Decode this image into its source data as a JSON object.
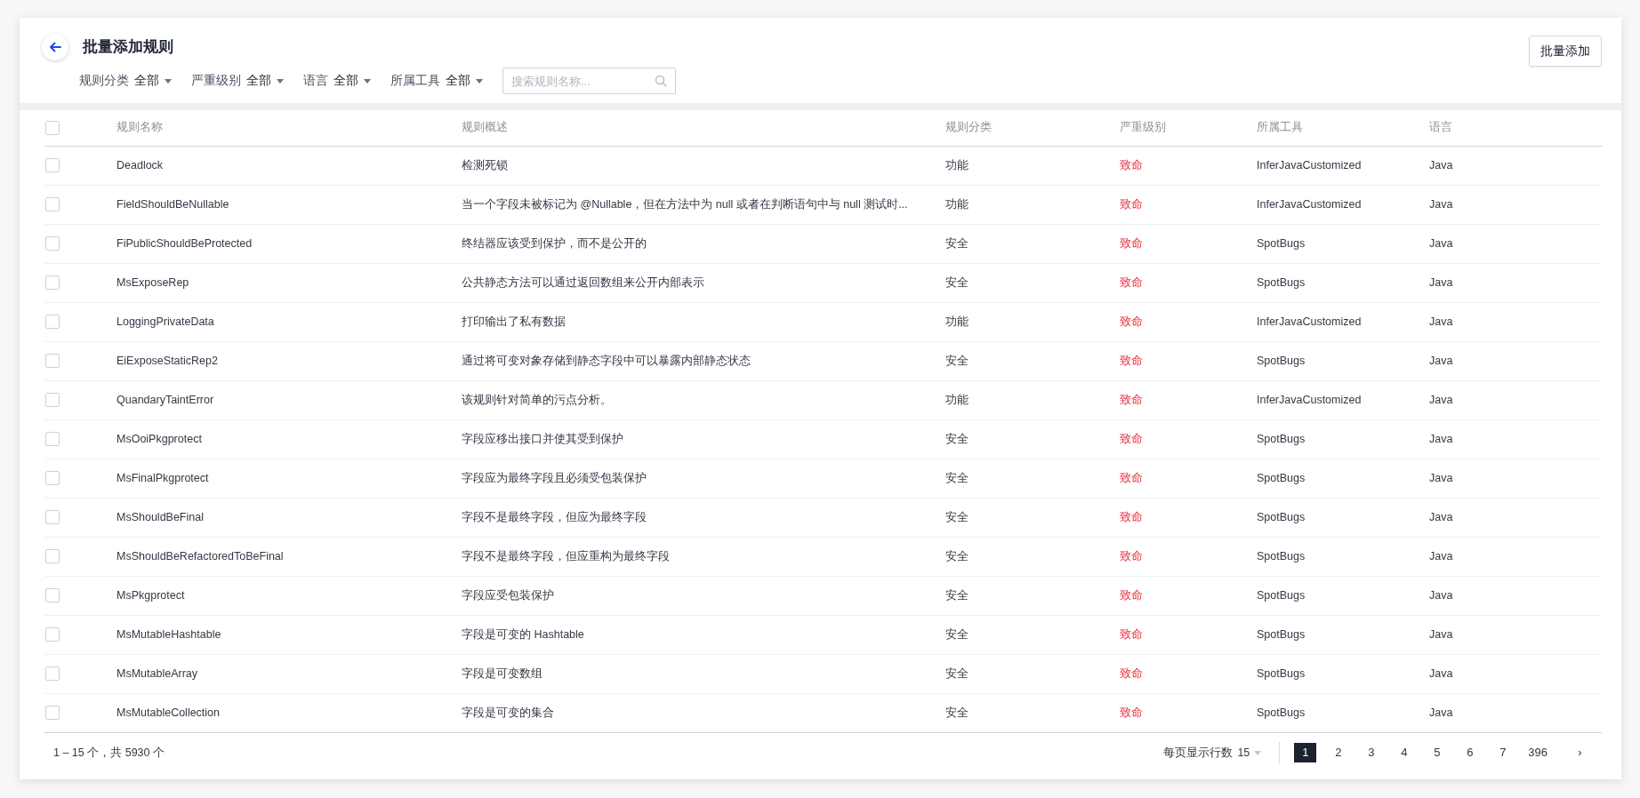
{
  "page": {
    "title": "批量添加规则",
    "action_button": "批量添加"
  },
  "filters": [
    {
      "label": "规则分类",
      "value": "全部"
    },
    {
      "label": "严重级别",
      "value": "全部"
    },
    {
      "label": "语言",
      "value": "全部"
    },
    {
      "label": "所属工具",
      "value": "全部"
    }
  ],
  "search": {
    "placeholder": "搜索规则名称..."
  },
  "table": {
    "select_all_checked": false,
    "columns": [
      "规则名称",
      "规则概述",
      "规则分类",
      "严重级别",
      "所属工具",
      "语言"
    ],
    "rows": [
      {
        "checked": false,
        "cells": [
          "Deadlock",
          "检测死锁",
          "功能",
          "致命",
          "InferJavaCustomized",
          "Java"
        ]
      },
      {
        "checked": false,
        "cells": [
          "FieldShouldBeNullable",
          "当一个字段未被标记为 @Nullable，但在方法中为 null 或者在判断语句中与 null 测试时...",
          "功能",
          "致命",
          "InferJavaCustomized",
          "Java"
        ]
      },
      {
        "checked": false,
        "cells": [
          "FiPublicShouldBeProtected",
          "终结器应该受到保护，而不是公开的",
          "安全",
          "致命",
          "SpotBugs",
          "Java"
        ]
      },
      {
        "checked": false,
        "cells": [
          "MsExposeRep",
          "公共静态方法可以通过返回数组来公开内部表示",
          "安全",
          "致命",
          "SpotBugs",
          "Java"
        ]
      },
      {
        "checked": false,
        "cells": [
          "LoggingPrivateData",
          "打印输出了私有数据",
          "功能",
          "致命",
          "InferJavaCustomized",
          "Java"
        ]
      },
      {
        "checked": false,
        "cells": [
          "EiExposeStaticRep2",
          "通过将可变对象存储到静态字段中可以暴露内部静态状态",
          "安全",
          "致命",
          "SpotBugs",
          "Java"
        ]
      },
      {
        "checked": false,
        "cells": [
          "QuandaryTaintError",
          "该规则针对简单的污点分析。",
          "功能",
          "致命",
          "InferJavaCustomized",
          "Java"
        ]
      },
      {
        "checked": false,
        "cells": [
          "MsOoiPkgprotect",
          "字段应移出接口并使其受到保护",
          "安全",
          "致命",
          "SpotBugs",
          "Java"
        ]
      },
      {
        "checked": false,
        "cells": [
          "MsFinalPkgprotect",
          "字段应为最终字段且必须受包装保护",
          "安全",
          "致命",
          "SpotBugs",
          "Java"
        ]
      },
      {
        "checked": false,
        "cells": [
          "MsShouldBeFinal",
          "字段不是最终字段，但应为最终字段",
          "安全",
          "致命",
          "SpotBugs",
          "Java"
        ]
      },
      {
        "checked": false,
        "cells": [
          "MsShouldBeRefactoredToBeFinal",
          "字段不是最终字段，但应重构为最终字段",
          "安全",
          "致命",
          "SpotBugs",
          "Java"
        ]
      },
      {
        "checked": false,
        "cells": [
          "MsPkgprotect",
          "字段应受包装保护",
          "安全",
          "致命",
          "SpotBugs",
          "Java"
        ]
      },
      {
        "checked": false,
        "cells": [
          "MsMutableHashtable",
          "字段是可变的 Hashtable",
          "安全",
          "致命",
          "SpotBugs",
          "Java"
        ]
      },
      {
        "checked": false,
        "cells": [
          "MsMutableArray",
          "字段是可变数组",
          "安全",
          "致命",
          "SpotBugs",
          "Java"
        ]
      },
      {
        "checked": false,
        "cells": [
          "MsMutableCollection",
          "字段是可变的集合",
          "安全",
          "致命",
          "SpotBugs",
          "Java"
        ]
      }
    ]
  },
  "footer": {
    "summary": "1 – 15 个，共 5930 个",
    "page_size_label": "每页显示行数",
    "page_size": "15",
    "pages": [
      {
        "label": "1",
        "selected": true
      },
      {
        "label": "2",
        "selected": false
      },
      {
        "label": "3",
        "selected": false
      },
      {
        "label": "4",
        "selected": false
      },
      {
        "label": "5",
        "selected": false
      },
      {
        "label": "6",
        "selected": false
      },
      {
        "label": "7",
        "selected": false
      },
      {
        "label": "396",
        "selected": false
      }
    ],
    "next": "›"
  }
}
